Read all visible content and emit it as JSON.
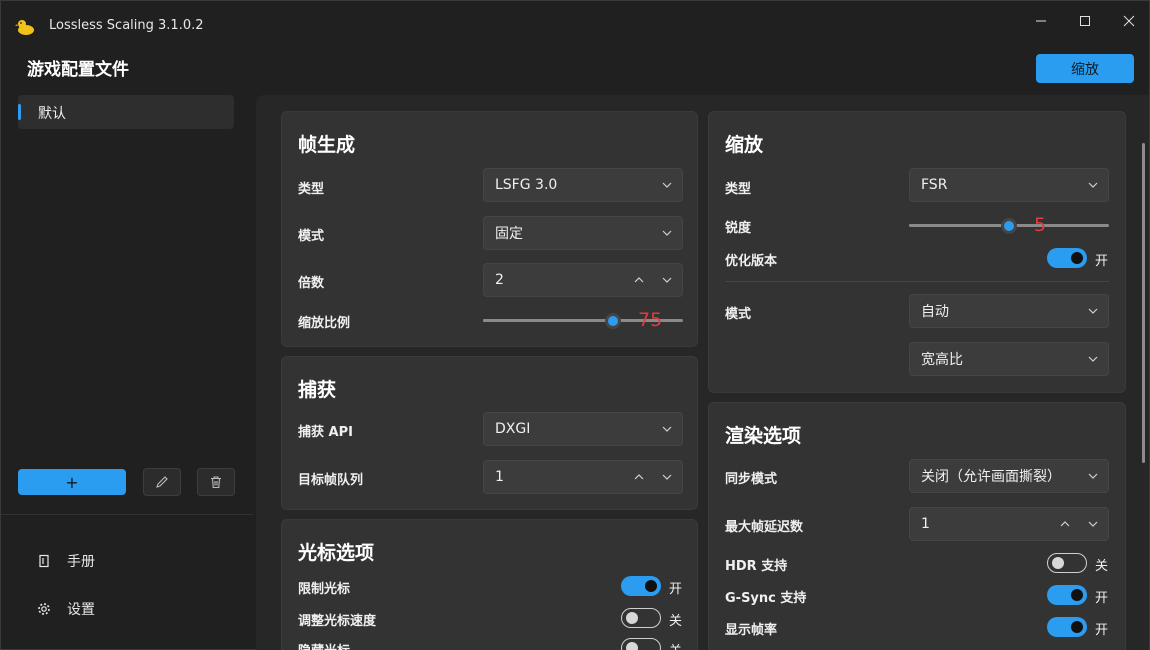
{
  "window": {
    "title": "Lossless Scaling 3.1.0.2",
    "logo_icon": "duck-icon",
    "controls": [
      "minimize-icon",
      "maximize-icon",
      "close-icon"
    ]
  },
  "header": {
    "profiles_heading": "游戏配置文件",
    "scale_button": "缩放"
  },
  "sidebar": {
    "profiles": [
      {
        "label": "默认",
        "selected": true
      }
    ],
    "add_label": "+",
    "edit_icon": "pencil-icon",
    "delete_icon": "trash-icon",
    "nav": [
      {
        "label": "手册",
        "icon": "book-icon"
      },
      {
        "label": "设置",
        "icon": "gear-icon"
      }
    ]
  },
  "frame_generation": {
    "title": "帧生成",
    "type": {
      "label": "类型",
      "value": "LSFG 3.0"
    },
    "mode": {
      "label": "模式",
      "value": "固定"
    },
    "multiplier": {
      "label": "倍数",
      "value": "2"
    },
    "resolution_scale": {
      "label": "缩放比例",
      "value": "75",
      "fraction": 0.65
    }
  },
  "capture": {
    "title": "捕获",
    "api": {
      "label": "捕获 API",
      "value": "DXGI"
    },
    "queue_target": {
      "label": "目标帧队列",
      "value": "1"
    }
  },
  "cursor": {
    "title": "光标选项",
    "clip_cursor": {
      "label": "限制光标",
      "on": true,
      "state_text": "开"
    },
    "adjust_speed": {
      "label": "调整光标速度",
      "on": false,
      "state_text": "关"
    },
    "hide_cursor": {
      "label": "隐藏光标",
      "on": false,
      "state_text": "关"
    }
  },
  "scaling": {
    "title": "缩放",
    "type": {
      "label": "类型",
      "value": "FSR"
    },
    "sharpness": {
      "label": "锐度",
      "value": "5",
      "fraction": 0.5
    },
    "optimized": {
      "label": "优化版本",
      "on": true,
      "state_text": "开"
    },
    "mode": {
      "label": "模式",
      "value": "自动"
    },
    "aspect": {
      "value": "宽高比"
    }
  },
  "rendering": {
    "title": "渲染选项",
    "sync_mode": {
      "label": "同步模式",
      "value": "关闭（允许画面撕裂）"
    },
    "max_frame_latency": {
      "label": "最大帧延迟数",
      "value": "1"
    },
    "hdr": {
      "label": "HDR 支持",
      "on": false,
      "state_text": "关"
    },
    "gsync": {
      "label": "G-Sync 支持",
      "on": true,
      "state_text": "开"
    },
    "show_fps": {
      "label": "显示帧率",
      "on": true,
      "state_text": "开"
    }
  },
  "colors": {
    "accent": "#2a9df0",
    "background": "#202020",
    "card": "#333333",
    "slider_value": "#e23b3b"
  }
}
